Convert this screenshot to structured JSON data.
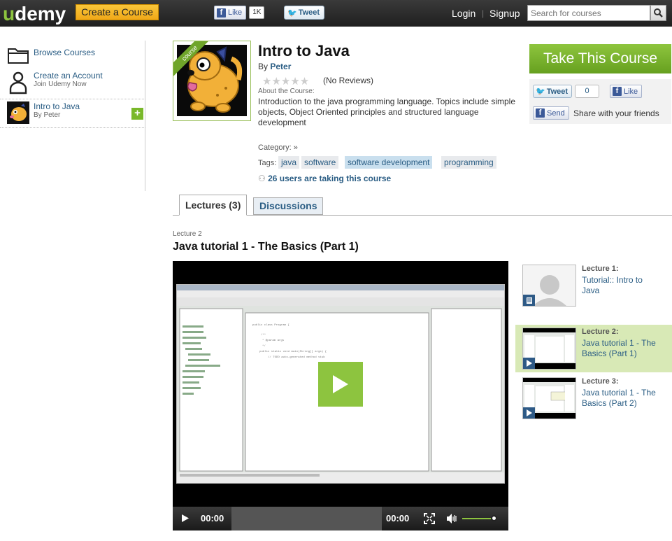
{
  "header": {
    "logo": "udemy",
    "create_course": "Create a Course",
    "fb_like": "Like",
    "fb_like_count": "1K",
    "tweet": "Tweet",
    "login": "Login",
    "separator": "|",
    "signup": "Signup",
    "search_placeholder": "Search for courses"
  },
  "sidebar": {
    "browse": "Browse Courses",
    "create_account": "Create an Account",
    "create_account_sub": "Join Udemy Now",
    "course_title": "Intro to Java",
    "course_by": "By Peter"
  },
  "course": {
    "ribbon": "course",
    "title": "Intro to Java",
    "by_label": "By",
    "author": "Peter",
    "stars": "★★★★★",
    "reviews": "(No Reviews)",
    "about_label": "About the Course:",
    "about": "Introduction to the java programming language. Topics include simple objects, Object Oriented principles and structured language development",
    "category_label": "Category:",
    "category_value": "»",
    "tags_label": "Tags:",
    "tags": [
      "java",
      "software",
      "software development",
      "programming"
    ],
    "users": "26 users are taking this course"
  },
  "share": {
    "take_course": "Take This Course",
    "tweet": "Tweet",
    "tweet_count": "0",
    "like": "Like",
    "send": "Send",
    "share_text": "Share with your friends"
  },
  "tabs": {
    "lectures": "Lectures (3)",
    "discussions": "Discussions"
  },
  "current_lecture": {
    "label": "Lecture 2",
    "title": "Java tutorial 1 - The Basics (Part 1)"
  },
  "player": {
    "current_time": "00:00",
    "total_time": "00:00",
    "volume": 0.9
  },
  "lectures": [
    {
      "num": "Lecture 1:",
      "title": "Tutorial:: Intro to Java"
    },
    {
      "num": "Lecture 2:",
      "title": "Java tutorial 1 - The Basics (Part 1)"
    },
    {
      "num": "Lecture 3:",
      "title": "Java tutorial 1 - The Basics (Part 2)"
    }
  ],
  "colors": {
    "accent_green": "#8dc43f",
    "link_blue": "#2a5d84",
    "create_yellow": "#f9c63a"
  }
}
